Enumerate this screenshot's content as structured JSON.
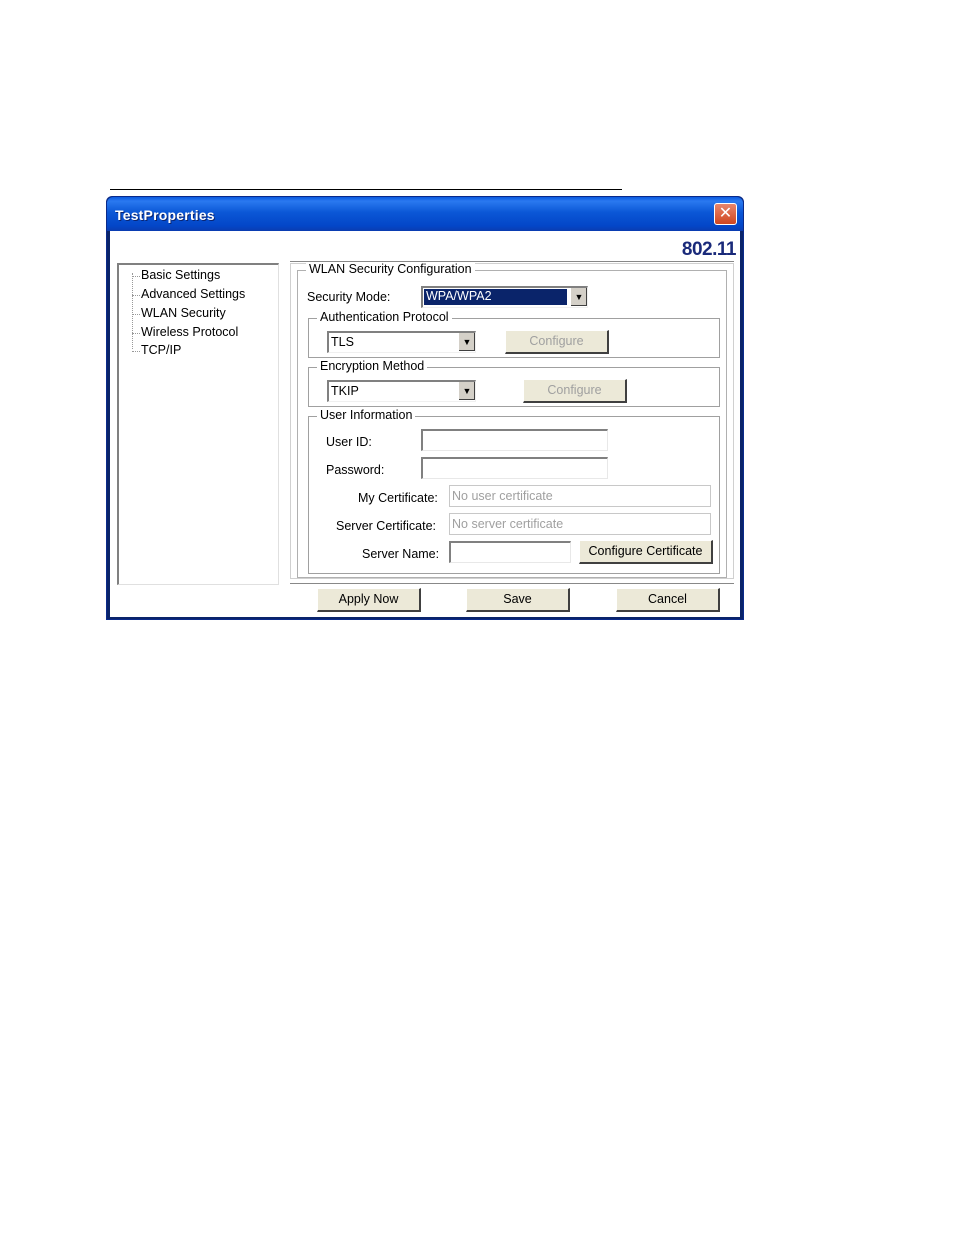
{
  "window": {
    "title": "TestProperties",
    "brand": "802.11",
    "close_glyph": "✕"
  },
  "sidebar": {
    "items": [
      {
        "label": "Basic Settings"
      },
      {
        "label": "Advanced Settings"
      },
      {
        "label": "WLAN Security"
      },
      {
        "label": "Wireless Protocol"
      },
      {
        "label": "TCP/IP"
      }
    ]
  },
  "wlan_security": {
    "group_label": "WLAN Security Configuration",
    "security_mode_label": "Security Mode:",
    "security_mode_value": "WPA/WPA2",
    "auth": {
      "group_label": "Authentication Protocol",
      "value": "TLS",
      "configure_label": "Configure"
    },
    "encryption": {
      "group_label": "Encryption Method",
      "value": "TKIP",
      "configure_label": "Configure"
    },
    "user_info": {
      "group_label": "User Information",
      "user_id_label": "User ID:",
      "user_id_value": "",
      "password_label": "Password:",
      "password_value": "",
      "my_cert_label": "My Certificate:",
      "my_cert_placeholder": "No user certificate",
      "server_cert_label": "Server Certificate:",
      "server_cert_placeholder": "No server certificate",
      "server_name_label": "Server Name:",
      "server_name_value": "",
      "configure_cert_label": "Configure Certificate"
    }
  },
  "footer": {
    "apply_label": "Apply Now",
    "save_label": "Save",
    "cancel_label": "Cancel"
  },
  "icons": {
    "dropdown_arrow": "▼"
  }
}
